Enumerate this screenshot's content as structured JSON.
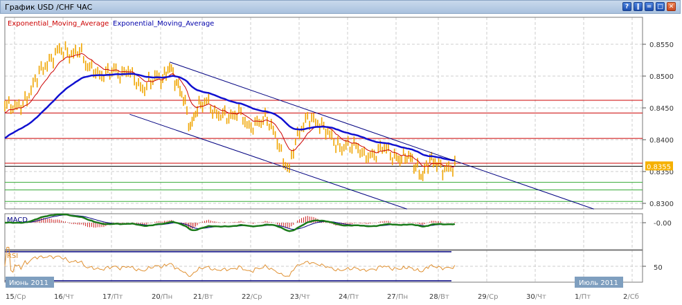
{
  "window": {
    "title": "График USD /CHF  ЧАС",
    "buttons": [
      {
        "name": "help",
        "glyph": "?"
      },
      {
        "name": "tile",
        "glyph": "‖"
      },
      {
        "name": "minimize",
        "glyph": "="
      },
      {
        "name": "maximize",
        "glyph": "□"
      },
      {
        "name": "close",
        "glyph": "✕"
      }
    ]
  },
  "chart_data": {
    "type": "candlestick",
    "title": "USD/CHF H1",
    "legend": [
      {
        "label": "Exponential_Moving_Average",
        "color": "#cc0000"
      },
      {
        "label": "Exponential_Moving_Average",
        "color": "#0000aa"
      }
    ],
    "colors": {
      "candles": "#f0a500",
      "ema_fast": "#cc0000",
      "ema_slow": "#1010d0",
      "macd": "#1a7a1a",
      "signal": "#000080",
      "rsi": "#e09030",
      "level_red": "#cc0000",
      "level_green": "#33aa33",
      "trend": "#000080",
      "price_tag": "#f5b000"
    },
    "ylim": [
      0.8285,
      0.858
    ],
    "y_ticks": [
      "0.8550",
      "0.8500",
      "0.8450",
      "0.8400",
      "0.8350",
      "0.8300"
    ],
    "y_tick_values": [
      0.855,
      0.85,
      0.845,
      0.84,
      0.835,
      0.83
    ],
    "current_price": "0.8355",
    "current_price_value": 0.8355,
    "x_ticks": [
      {
        "day": "15",
        "wd": "/Ср"
      },
      {
        "day": "16",
        "wd": "/Чт"
      },
      {
        "day": "17",
        "wd": "/Пт"
      },
      {
        "day": "20",
        "wd": "/Пн"
      },
      {
        "day": "21",
        "wd": "/Вт"
      },
      {
        "day": "22",
        "wd": "/Ср"
      },
      {
        "day": "23",
        "wd": "/Чт"
      },
      {
        "day": "24",
        "wd": "/Пт"
      },
      {
        "day": "27",
        "wd": "/Пн"
      },
      {
        "day": "28",
        "wd": "/Вт"
      },
      {
        "day": "29",
        "wd": "/Ср"
      },
      {
        "day": "30",
        "wd": "/Чт"
      },
      {
        "day": "1",
        "wd": "/Пт"
      },
      {
        "day": "2",
        "wd": "/Сб"
      }
    ],
    "month_labels": [
      "Июнь 2011",
      "Июль 2011"
    ],
    "price_path_day_index_vs_close": [
      [
        -0.2,
        0.8457
      ],
      [
        0,
        0.8451
      ],
      [
        0.2,
        0.8457
      ],
      [
        0.34,
        0.8478
      ],
      [
        0.49,
        0.8505
      ],
      [
        0.63,
        0.8516
      ],
      [
        0.77,
        0.8527
      ],
      [
        0.91,
        0.8543
      ],
      [
        1.06,
        0.8538
      ],
      [
        1.2,
        0.8533
      ],
      [
        1.34,
        0.8543
      ],
      [
        1.49,
        0.8516
      ],
      [
        1.63,
        0.8511
      ],
      [
        1.77,
        0.85
      ],
      [
        1.91,
        0.8505
      ],
      [
        2.06,
        0.8511
      ],
      [
        2.2,
        0.85
      ],
      [
        2.33,
        0.8511
      ],
      [
        2.48,
        0.8495
      ],
      [
        2.62,
        0.8478
      ],
      [
        2.76,
        0.8489
      ],
      [
        2.9,
        0.85
      ],
      [
        3.05,
        0.8495
      ],
      [
        3.22,
        0.8516
      ],
      [
        3.38,
        0.8489
      ],
      [
        3.55,
        0.8467
      ],
      [
        3.72,
        0.8418
      ],
      [
        3.88,
        0.8451
      ],
      [
        4.11,
        0.8462
      ],
      [
        4.26,
        0.844
      ],
      [
        4.4,
        0.844
      ],
      [
        4.61,
        0.8435
      ],
      [
        4.76,
        0.8446
      ],
      [
        4.97,
        0.8418
      ],
      [
        5.19,
        0.8429
      ],
      [
        5.33,
        0.8435
      ],
      [
        5.54,
        0.8402
      ],
      [
        5.69,
        0.8364
      ],
      [
        5.8,
        0.8353
      ],
      [
        5.89,
        0.8391
      ],
      [
        6.04,
        0.8418
      ],
      [
        6.19,
        0.8435
      ],
      [
        6.33,
        0.8429
      ],
      [
        6.54,
        0.8418
      ],
      [
        6.69,
        0.8402
      ],
      [
        6.83,
        0.8386
      ],
      [
        6.97,
        0.8391
      ],
      [
        7.19,
        0.8391
      ],
      [
        7.33,
        0.8375
      ],
      [
        7.54,
        0.8375
      ],
      [
        7.76,
        0.8391
      ],
      [
        7.9,
        0.8375
      ],
      [
        8.05,
        0.837
      ],
      [
        8.3,
        0.8375
      ],
      [
        8.46,
        0.8359
      ],
      [
        8.62,
        0.8342
      ],
      [
        8.79,
        0.837
      ],
      [
        8.95,
        0.8364
      ],
      [
        9.11,
        0.8353
      ],
      [
        9.36,
        0.8359
      ]
    ],
    "ema_init": {
      "fast": 0.844,
      "slow": 0.84
    },
    "ema_periods": {
      "fast": 12,
      "slow": 45
    },
    "levels_red": [
      0.8462,
      0.8442,
      0.8402,
      0.8363
    ],
    "levels_green": [
      0.8333,
      0.8321,
      0.8303
    ],
    "trendlines": [
      {
        "from": [
          3.22,
          0.8522
        ],
        "to": [
          12.21,
          0.8291
        ]
      },
      {
        "from": [
          2.37,
          0.844
        ],
        "to": [
          8.26,
          0.8291
        ]
      }
    ],
    "macd": {
      "label": "MACD",
      "tick": "-0.00",
      "tick_value": 0
    },
    "rsi": {
      "label": "RSI",
      "tick": "50",
      "tick_value": 50,
      "bands": [
        70,
        30
      ]
    }
  }
}
